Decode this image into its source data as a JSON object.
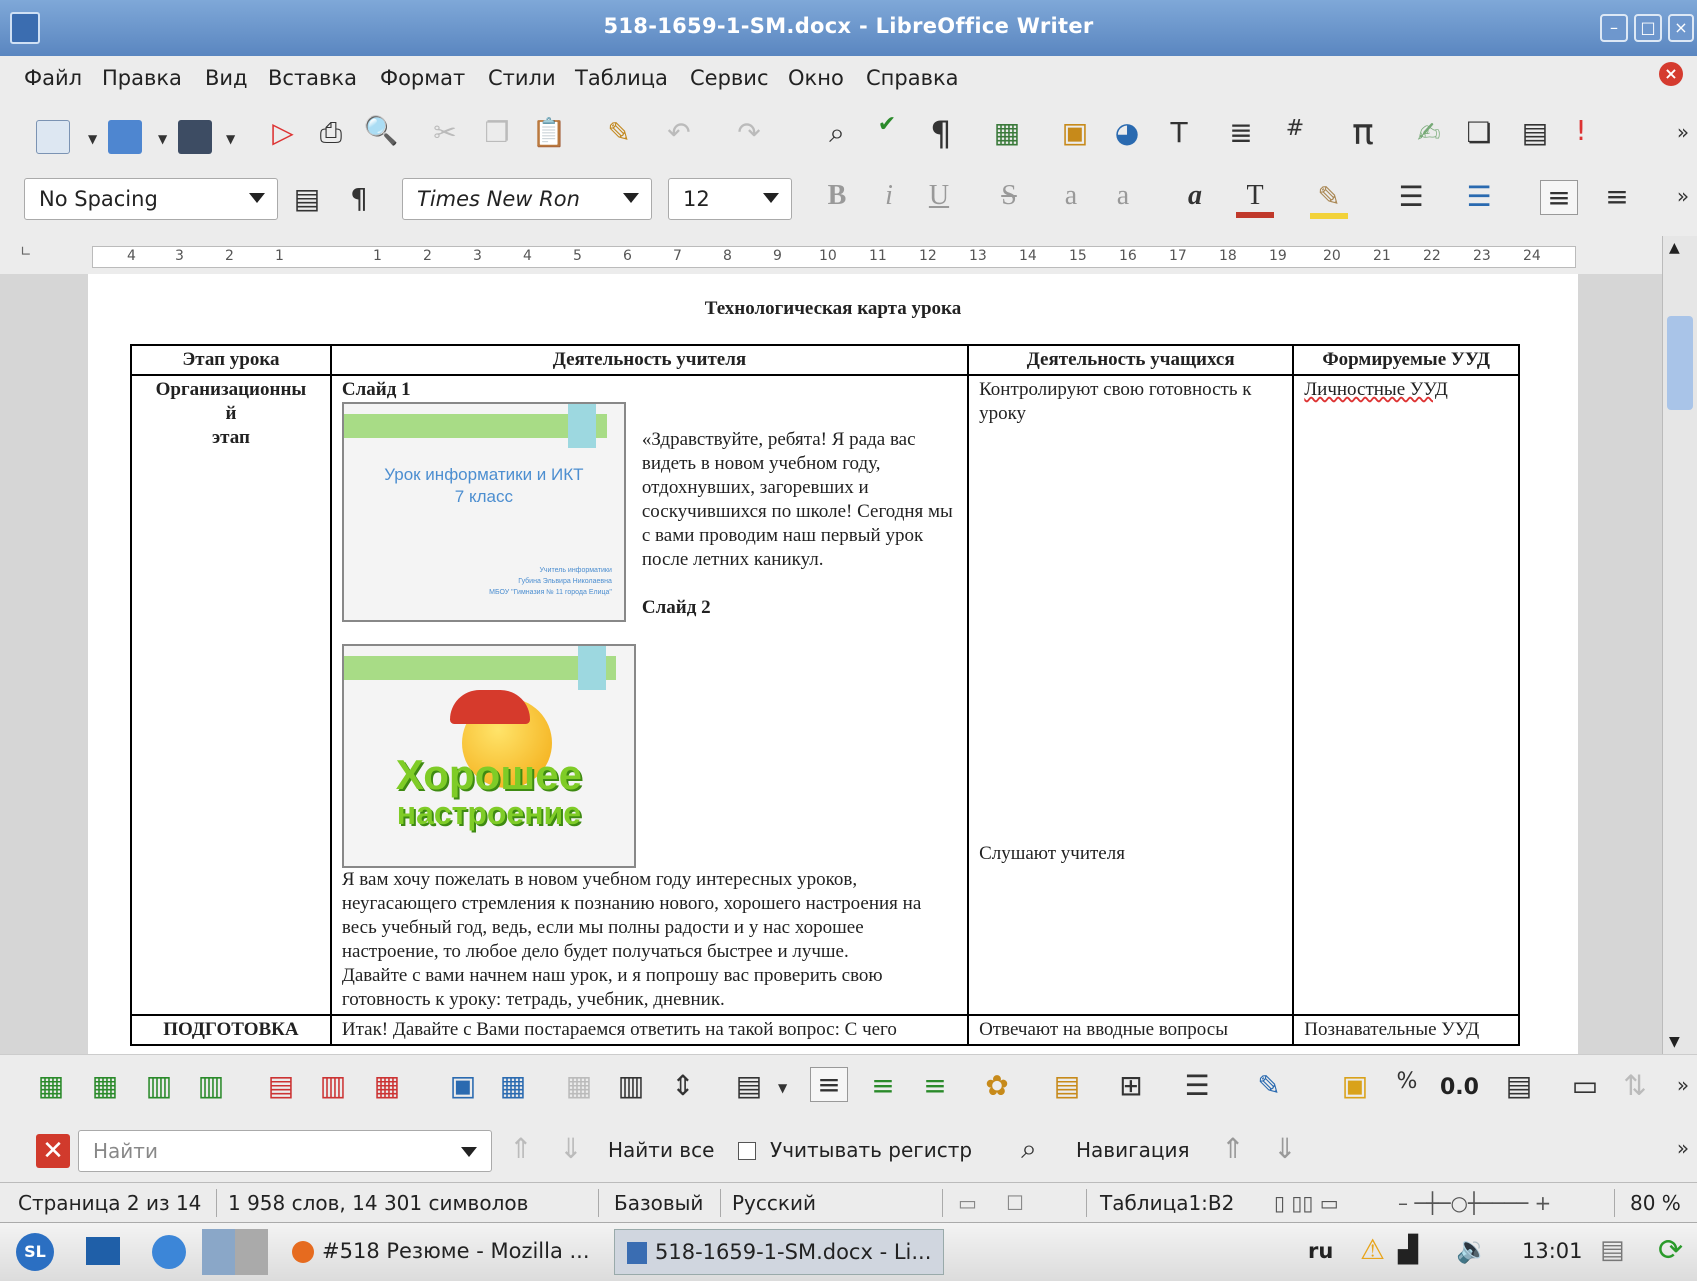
{
  "window": {
    "title": "518-1659-1-SM.docx - LibreOffice Writer"
  },
  "menu": {
    "items": [
      "Файл",
      "Правка",
      "Вид",
      "Вставка",
      "Формат",
      "Стили",
      "Таблица",
      "Сервис",
      "Окно",
      "Справка"
    ]
  },
  "formatting": {
    "paragraph_style": "No Spacing",
    "font_name": "Times New Ron",
    "font_size": "12"
  },
  "ruler": {
    "ticks": [
      "4",
      "3",
      "2",
      "1",
      "1",
      "2",
      "3",
      "4",
      "5",
      "6",
      "7",
      "8",
      "9",
      "10",
      "11",
      "12",
      "13",
      "14",
      "15",
      "16",
      "17",
      "18",
      "19",
      "20",
      "21",
      "22",
      "23",
      "24"
    ]
  },
  "document": {
    "heading": "Технологическая карта урока",
    "columns": [
      "Этап урока",
      "Деятельность учителя",
      "Деятельность учащихся",
      "Формируемые УУД"
    ],
    "row1": {
      "stage_lines": [
        "Организационны",
        "й",
        "этап"
      ],
      "slide1_label": "Слайд 1",
      "slide1_title_line1": "Урок информатики и ИКТ",
      "slide1_title_line2": "7 класс",
      "slide1_small": [
        "Учитель информатики",
        "Губина Эльвира Николаевна",
        "МБОУ \"Гимназия № 11 города Елица\""
      ],
      "greeting": "«Здравствуйте, ребята! Я рада вас видеть в новом учебном году, отдохнувших, загоревших и соскучившихся по школе! Сегодня мы с вами проводим наш первый урок после летних каникул.",
      "slide2_label": "Слайд 2",
      "slide2_text_line1": "Хорошее",
      "slide2_text_line2": "настроение",
      "wish": "Я вам хочу пожелать в новом учебном году интересных уроков, неугасающего стремления к познанию нового, хорошего настроения на весь учебный год, ведь, если мы полны радости и у нас хорошее настроение, то любое дело будет получаться быстрее и лучше.",
      "check": "Давайте с вами начнем наш урок, и я попрошу вас проверить свою готовность к уроку: тетрадь, учебник, дневник.",
      "students_1": "Контролируют свою готовность к уроку",
      "students_2": "Слушают учителя",
      "uud": "Личностные УУД"
    },
    "row2": {
      "stage": "ПОДГОТОВКА",
      "teacher": "Итак! Давайте с Вами постараемся ответить на такой вопрос: С чего",
      "students": "Отвечают на вводные вопросы",
      "uud": "Познавательные УУД"
    }
  },
  "table_toolbar": {
    "number_format": "0.0"
  },
  "findbar": {
    "placeholder": "Найти",
    "find_all": "Найти все",
    "match_case": "Учитывать регистр",
    "navigation": "Навигация"
  },
  "status": {
    "page": "Страница 2 из 14",
    "words": "1 958 слов, 14 301 символов",
    "page_style": "Базовый",
    "language": "Русский",
    "cell": "Таблица1:B2",
    "zoom": "80 %"
  },
  "taskbar": {
    "tasks": [
      "#518 Резюме - Mozilla ...",
      "518-1659-1-SM.docx - Li..."
    ],
    "keyboard": "ru",
    "clock": "13:01"
  },
  "colors": {
    "titlebar": "#5a86c0",
    "accent": "#a9c4e8"
  }
}
